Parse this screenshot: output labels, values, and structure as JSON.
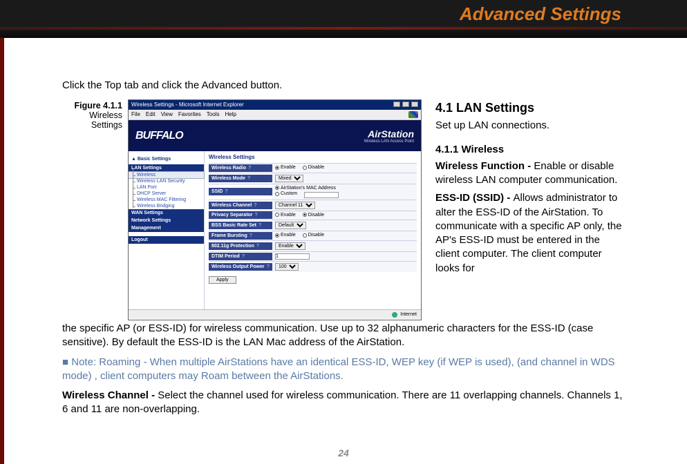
{
  "header": {
    "title": "Advanced Settings"
  },
  "lead": "Click the Top tab and click the Advanced button.",
  "figure_caption": {
    "label": "Figure 4.1.1",
    "sub1": "Wireless",
    "sub2": "Settings"
  },
  "screenshot": {
    "window_title": "Wireless Settings - Microsoft Internet Explorer",
    "menubar": [
      "File",
      "Edit",
      "View",
      "Favorites",
      "Tools",
      "Help"
    ],
    "brand": "BUFFALO",
    "product": "AirStation",
    "product_sub": "Wireless LAN Access Point",
    "basic_link": "▲ Basic Settings",
    "nav_heads": {
      "lan": "LAN Settings",
      "wan": "WAN Settings",
      "net": "Network Settings",
      "mgmt": "Management",
      "logout": "Logout"
    },
    "nav_items": [
      "Wireless",
      "Wireless LAN Security",
      "LAN Port",
      "DHCP Server",
      "Wireless MAC Filtering",
      "Wireless Bridging"
    ],
    "section_title": "Wireless Settings",
    "rows": {
      "radio": {
        "label": "Wireless Radio",
        "enable": "Enable",
        "disable": "Disable"
      },
      "mode": {
        "label": "Wireless Mode",
        "value": "Mixed"
      },
      "ssid": {
        "label": "SSID",
        "opt1": "AirStation's MAC Address",
        "opt2": "Custom",
        "custom_val": ""
      },
      "channel": {
        "label": "Wireless Channel",
        "value": "Channel 11"
      },
      "privsep": {
        "label": "Privacy Separator",
        "enable": "Enable",
        "disable": "Disable"
      },
      "bss": {
        "label": "BSS Basic Rate Set",
        "value": "Default"
      },
      "frame": {
        "label": "Frame Bursting",
        "enable": "Enable",
        "disable": "Disable"
      },
      "prot": {
        "label": "802.11g Protection",
        "value": "Enable"
      },
      "dtim": {
        "label": "DTIM Period",
        "value": "1"
      },
      "out": {
        "label": "Wireless Output Power",
        "value": "100"
      }
    },
    "apply": "Apply",
    "status": "Internet"
  },
  "section41": {
    "title": "4.1 LAN Settings",
    "sub": "Set up LAN connections.",
    "h411": "4.1.1 Wireless",
    "wf_label": "Wireless Function - ",
    "wf_text": "Enable or disable wireless LAN computer communication.",
    "ess_label": "ESS-ID (SSID) - ",
    "ess_text_a": "Allows administrator to alter the ESS-ID of the AirStation.  To communicate with a specific  AP only,  the AP's ESS-ID must be entered in the client computer. The client computer looks for",
    "ess_text_b": "the specific AP (or ESS-ID) for wireless communication.  Use up to 32 alphanumeric characters for the ESS-ID (case sensitive).  By default the ESS-ID is the LAN Mac address of the AirStation.",
    "note": "Note:  Roaming - When multiple AirStations have an identical ESS-ID, WEP key (if WEP is used), (and channel in WDS mode) , client computers may Roam between the AirStations.",
    "wc_label": "Wireless Channel  - ",
    "wc_text": "Select the channel used for wireless communication.  There are 11 overlapping channels. Channels 1, 6 and 11 are non-overlapping."
  },
  "page_number": "24"
}
